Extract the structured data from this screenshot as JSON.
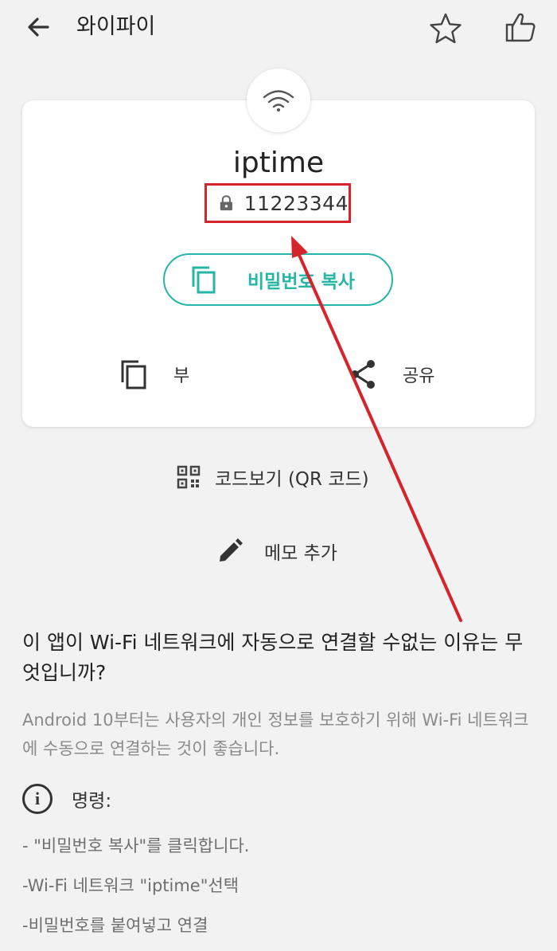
{
  "header": {
    "title": "와이파이"
  },
  "icons": {
    "back": "back-arrow-icon",
    "favorite": "star-icon",
    "like": "thumbs-up-icon",
    "wifi": "wifi-icon",
    "lock": "lock-icon",
    "copy": "copy-icon",
    "share": "share-icon",
    "qr": "qr-code-icon",
    "edit": "pencil-icon",
    "info": "info-icon"
  },
  "network": {
    "ssid": "iptime",
    "password": "11223344"
  },
  "buttons": {
    "copy_password": "비밀번호 복사",
    "copy": "부",
    "share": "공유",
    "qr": "코드보기 (QR 코드)",
    "memo": "메모 추가"
  },
  "faq": {
    "question": "이 앱이 Wi-Fi 네트워크에 자동으로 연결할 수없는 이유는 무엇입니까?",
    "answer": "Android 10부터는 사용자의 개인 정보를 보호하기 위해 Wi-Fi 네트워크에 수동으로 연결하는 것이 좋습니다."
  },
  "instructions": {
    "title": "명령:",
    "steps": [
      "- \"비밀번호 복사\"를 클릭합니다.",
      "-Wi-Fi 네트워크 \"iptime\"선택",
      "-비밀번호를 붙여넣고 연결"
    ]
  },
  "colors": {
    "accent": "#26b6a7",
    "highlight": "#d6252a",
    "background": "#f2f2f2"
  }
}
